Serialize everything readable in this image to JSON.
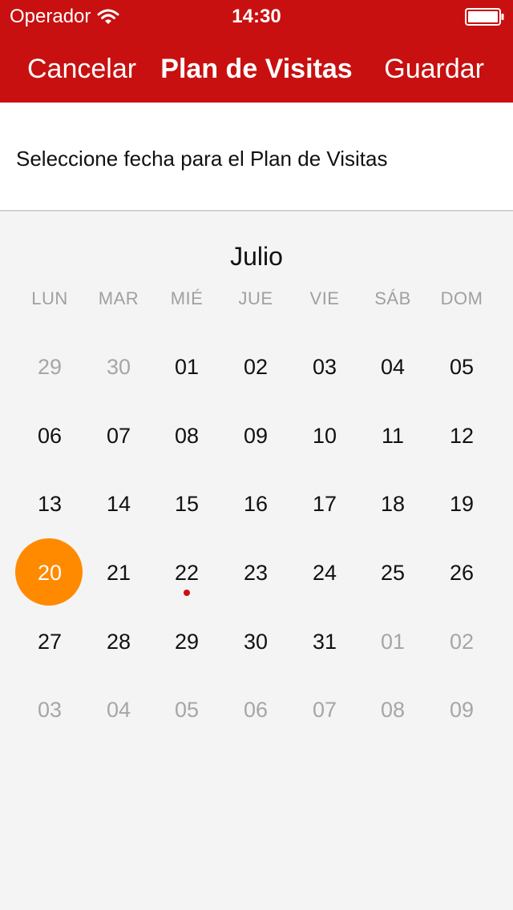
{
  "status_bar": {
    "carrier": "Operador",
    "time": "14:30",
    "wifi_icon": "wifi-icon",
    "battery_icon": "battery-icon"
  },
  "nav": {
    "cancel_label": "Cancelar",
    "title": "Plan de Visitas",
    "save_label": "Guardar"
  },
  "instruction": "Seleccione fecha para el Plan de Visitas",
  "calendar": {
    "month": "Julio",
    "weekdays": [
      "LUN",
      "MAR",
      "MIÉ",
      "JUE",
      "VIE",
      "SÁB",
      "DOM"
    ],
    "weeks": [
      [
        {
          "d": "29",
          "muted": true
        },
        {
          "d": "30",
          "muted": true
        },
        {
          "d": "01"
        },
        {
          "d": "02"
        },
        {
          "d": "03"
        },
        {
          "d": "04"
        },
        {
          "d": "05"
        }
      ],
      [
        {
          "d": "06"
        },
        {
          "d": "07"
        },
        {
          "d": "08"
        },
        {
          "d": "09"
        },
        {
          "d": "10"
        },
        {
          "d": "11"
        },
        {
          "d": "12"
        }
      ],
      [
        {
          "d": "13"
        },
        {
          "d": "14"
        },
        {
          "d": "15"
        },
        {
          "d": "16"
        },
        {
          "d": "17"
        },
        {
          "d": "18"
        },
        {
          "d": "19"
        }
      ],
      [
        {
          "d": "20",
          "today": true
        },
        {
          "d": "21"
        },
        {
          "d": "22",
          "event": true
        },
        {
          "d": "23"
        },
        {
          "d": "24"
        },
        {
          "d": "25"
        },
        {
          "d": "26"
        }
      ],
      [
        {
          "d": "27"
        },
        {
          "d": "28"
        },
        {
          "d": "29"
        },
        {
          "d": "30"
        },
        {
          "d": "31"
        },
        {
          "d": "01",
          "muted": true
        },
        {
          "d": "02",
          "muted": true
        }
      ],
      [
        {
          "d": "03",
          "muted": true
        },
        {
          "d": "04",
          "muted": true
        },
        {
          "d": "05",
          "muted": true
        },
        {
          "d": "06",
          "muted": true
        },
        {
          "d": "07",
          "muted": true
        },
        {
          "d": "08",
          "muted": true
        },
        {
          "d": "09",
          "muted": true
        }
      ]
    ]
  },
  "colors": {
    "header": "#c81010",
    "today": "#ff8a00",
    "event_dot": "#d01010",
    "muted_text": "#a6a6a6"
  }
}
